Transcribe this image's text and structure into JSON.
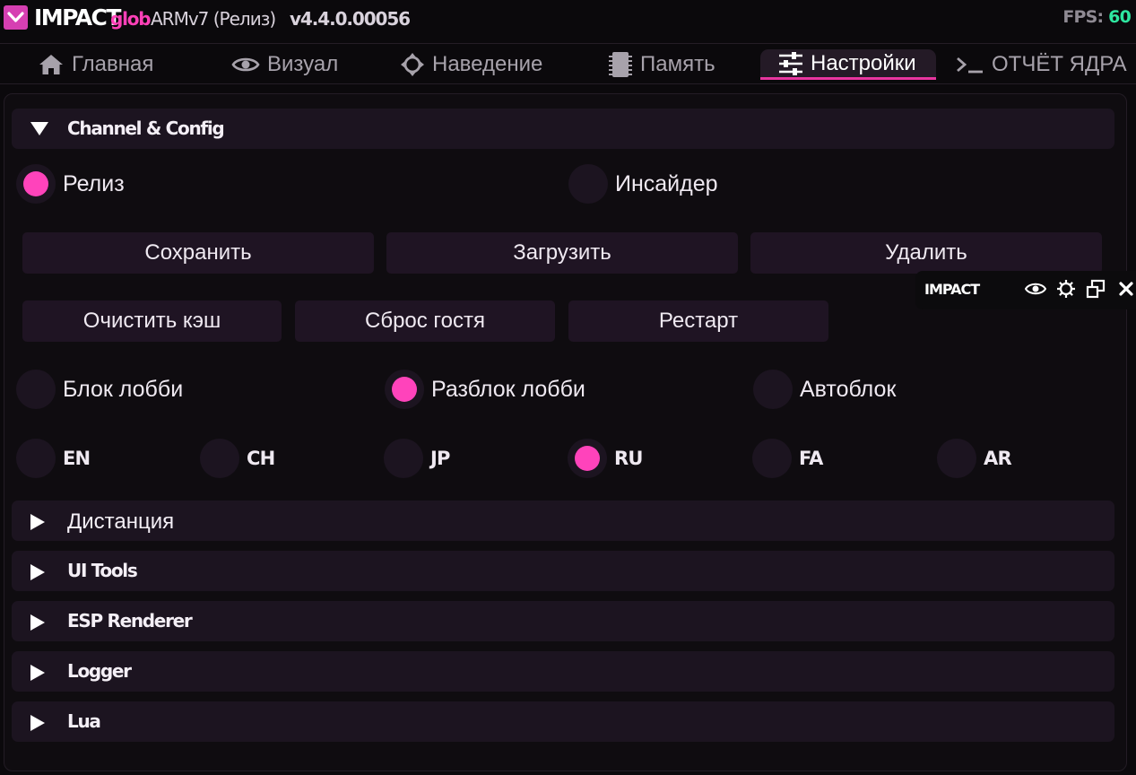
{
  "titlebar": {
    "brand": "IMPACT",
    "edition": "glob",
    "build": "ARMv7 (Релиз)",
    "version": "v4.4.0.00056",
    "fps_label": "FPS:",
    "fps_value": "60"
  },
  "tabs": [
    {
      "label": "Главная",
      "icon": "home-icon",
      "active": false
    },
    {
      "label": "Визуал",
      "icon": "eye-icon",
      "active": false
    },
    {
      "label": "Наведение",
      "icon": "crosshair-icon",
      "active": false
    },
    {
      "label": "Память",
      "icon": "chip-icon",
      "active": false
    },
    {
      "label": "Настройки",
      "icon": "sliders-icon",
      "active": true
    },
    {
      "label": "ОТЧЁТ ЯДРА",
      "icon": "terminal-icon",
      "active": false
    }
  ],
  "channel": {
    "header": "Channel & Config",
    "expanded": true,
    "options": [
      {
        "label": "Релиз",
        "selected": true
      },
      {
        "label": "Инсайдер",
        "selected": false
      }
    ]
  },
  "config_buttons": [
    "Сохранить",
    "Загрузить",
    "Удалить"
  ],
  "action_buttons": [
    "Очистить кэш",
    "Сброс гостя",
    "Рестарт"
  ],
  "lobby": [
    {
      "label": "Блок лобби",
      "selected": false
    },
    {
      "label": "Разблок лобби",
      "selected": true
    },
    {
      "label": "Автоблок",
      "selected": false
    }
  ],
  "languages": [
    {
      "label": "EN",
      "selected": false
    },
    {
      "label": "CH",
      "selected": false
    },
    {
      "label": "JP",
      "selected": false
    },
    {
      "label": "RU",
      "selected": true
    },
    {
      "label": "FA",
      "selected": false
    },
    {
      "label": "AR",
      "selected": false
    }
  ],
  "collapsed_sections": [
    "Дистанция",
    "UI Tools",
    "ESP Renderer",
    "Logger",
    "Lua"
  ],
  "overlay": {
    "title": "IMPACT",
    "icons": [
      "eye-icon",
      "gear-icon",
      "windows-icon",
      "close-icon"
    ]
  },
  "colors": {
    "accent": "#ff43bb",
    "fps": "#2ee6a0",
    "panel": "#1c1420"
  }
}
